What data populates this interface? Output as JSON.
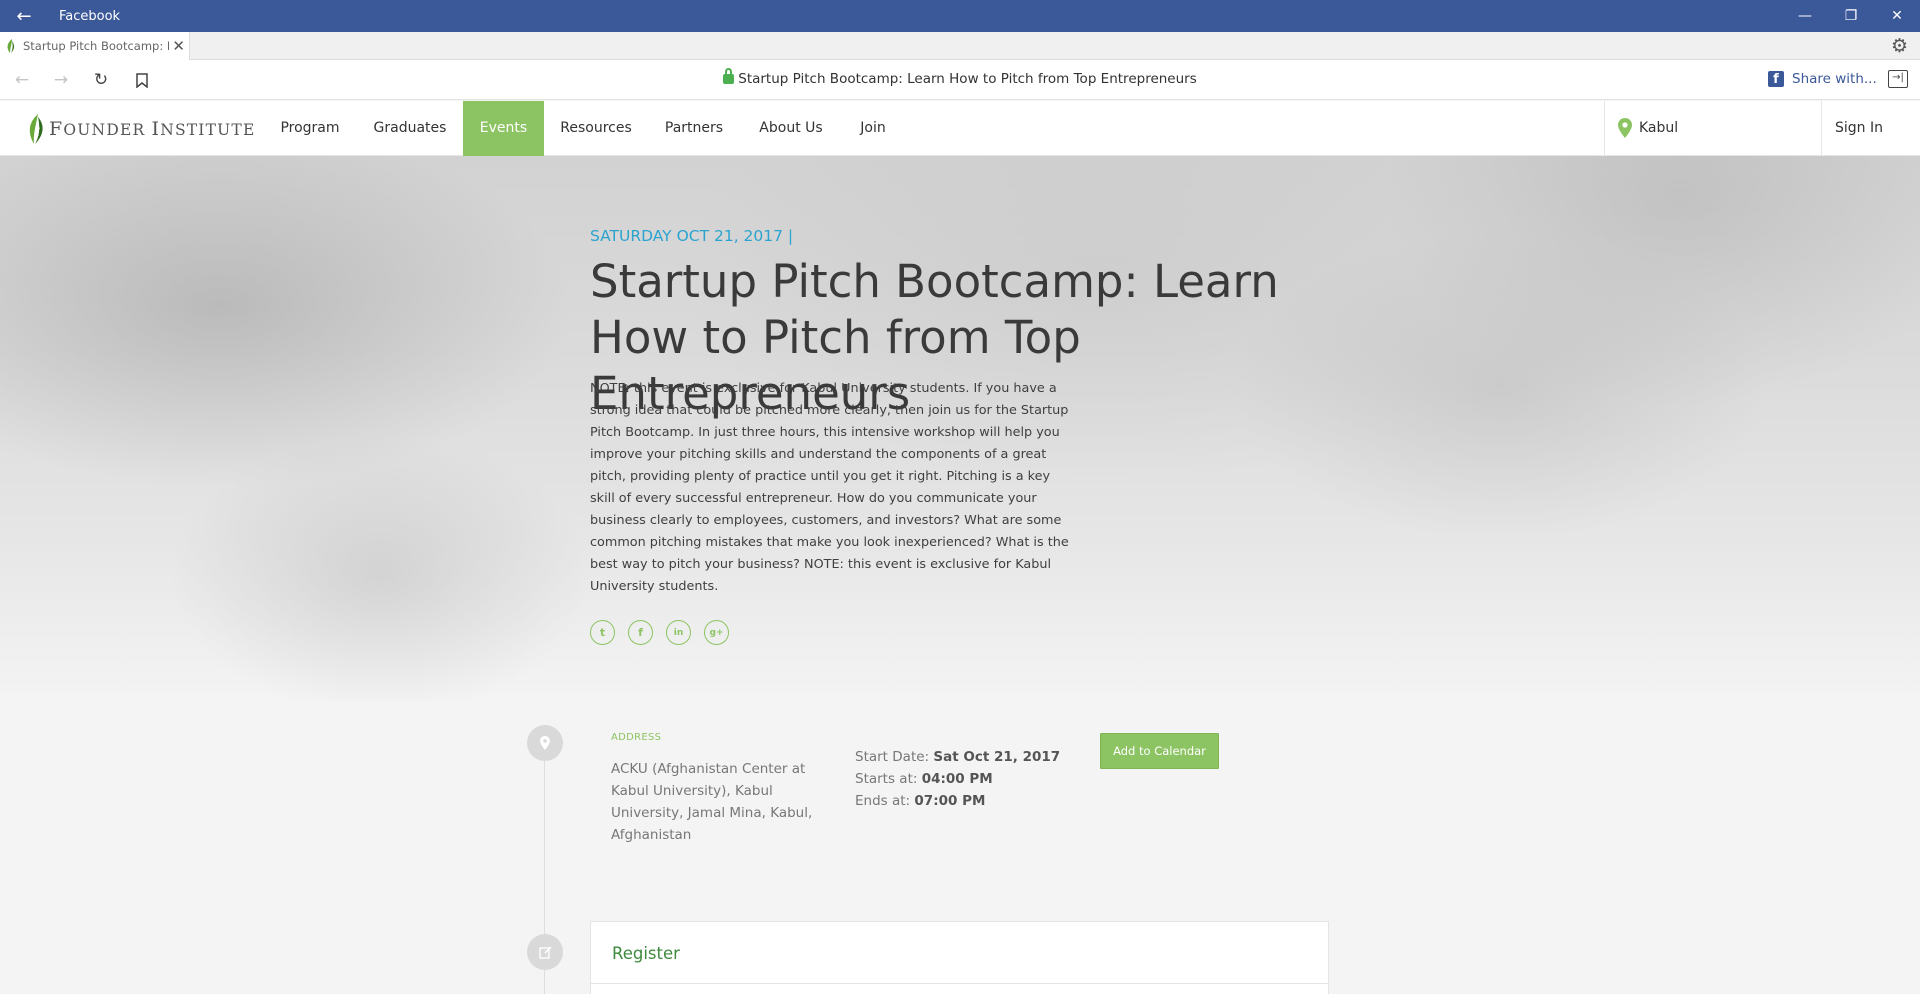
{
  "window": {
    "app_title": "Facebook",
    "back_icon": "arrow-left-icon"
  },
  "tab": {
    "label": "Startup Pitch Bootcamp: Learn How to Pitch from Top Entrepreneurs",
    "close": "✕"
  },
  "address_bar": {
    "page_title": "Startup Pitch Bootcamp: Learn How to Pitch from Top Entrepreneurs",
    "share_label": "Share with..."
  },
  "site_nav": {
    "logo_first": "F",
    "logo_rest": "OUNDER ",
    "logo_second": "I",
    "logo_rest2": "NSTITUTE",
    "items": [
      {
        "label": "Program"
      },
      {
        "label": "Graduates"
      },
      {
        "label": "Events"
      },
      {
        "label": "Resources"
      },
      {
        "label": "Partners"
      },
      {
        "label": "About Us"
      },
      {
        "label": "Join"
      }
    ],
    "active": "Events",
    "location": "Kabul",
    "sign_in": "Sign In"
  },
  "event": {
    "date_line": "SATURDAY OCT 21, 2017 |",
    "title": "Startup Pitch Bootcamp: Learn How to Pitch from Top Entrepreneurs",
    "description": "NOTE: this event is exclusive for Kabul University students. If you have a strong idea that could be pitched more clearly, then join us for the Startup Pitch Bootcamp. In just three hours, this intensive workshop will help you improve your pitching skills and understand the components of a great pitch, providing plenty of practice until you get it right. Pitching is a key skill of every successful entrepreneur. How do you communicate your business clearly to employees, customers, and investors? What are some common pitching mistakes that make you look inexperienced? What is the best way to pitch your business? NOTE: this event is exclusive for Kabul University students.",
    "socials": [
      {
        "name": "twitter-icon",
        "glyph": "t"
      },
      {
        "name": "facebook-icon",
        "glyph": "f"
      },
      {
        "name": "linkedin-icon",
        "glyph": "in"
      },
      {
        "name": "google-plus-icon",
        "glyph": "g+"
      }
    ]
  },
  "details": {
    "address_label": "ADDRESS",
    "address": "ACKU (Afghanistan Center at Kabul University), Kabul University, Jamal Mina, Kabul, Afghanistan",
    "start_date_label": "Start Date:",
    "start_date": "Sat Oct 21, 2017",
    "starts_at_label": "Starts at:",
    "starts_at": "04:00 PM",
    "ends_at_label": "Ends at:",
    "ends_at": "07:00 PM",
    "calendar_button": "Add to Calendar"
  },
  "register": {
    "title": "Register"
  },
  "colors": {
    "titlebar": "#3b5998",
    "accent_green": "#8dc463",
    "date_blue": "#2aa4cf"
  }
}
